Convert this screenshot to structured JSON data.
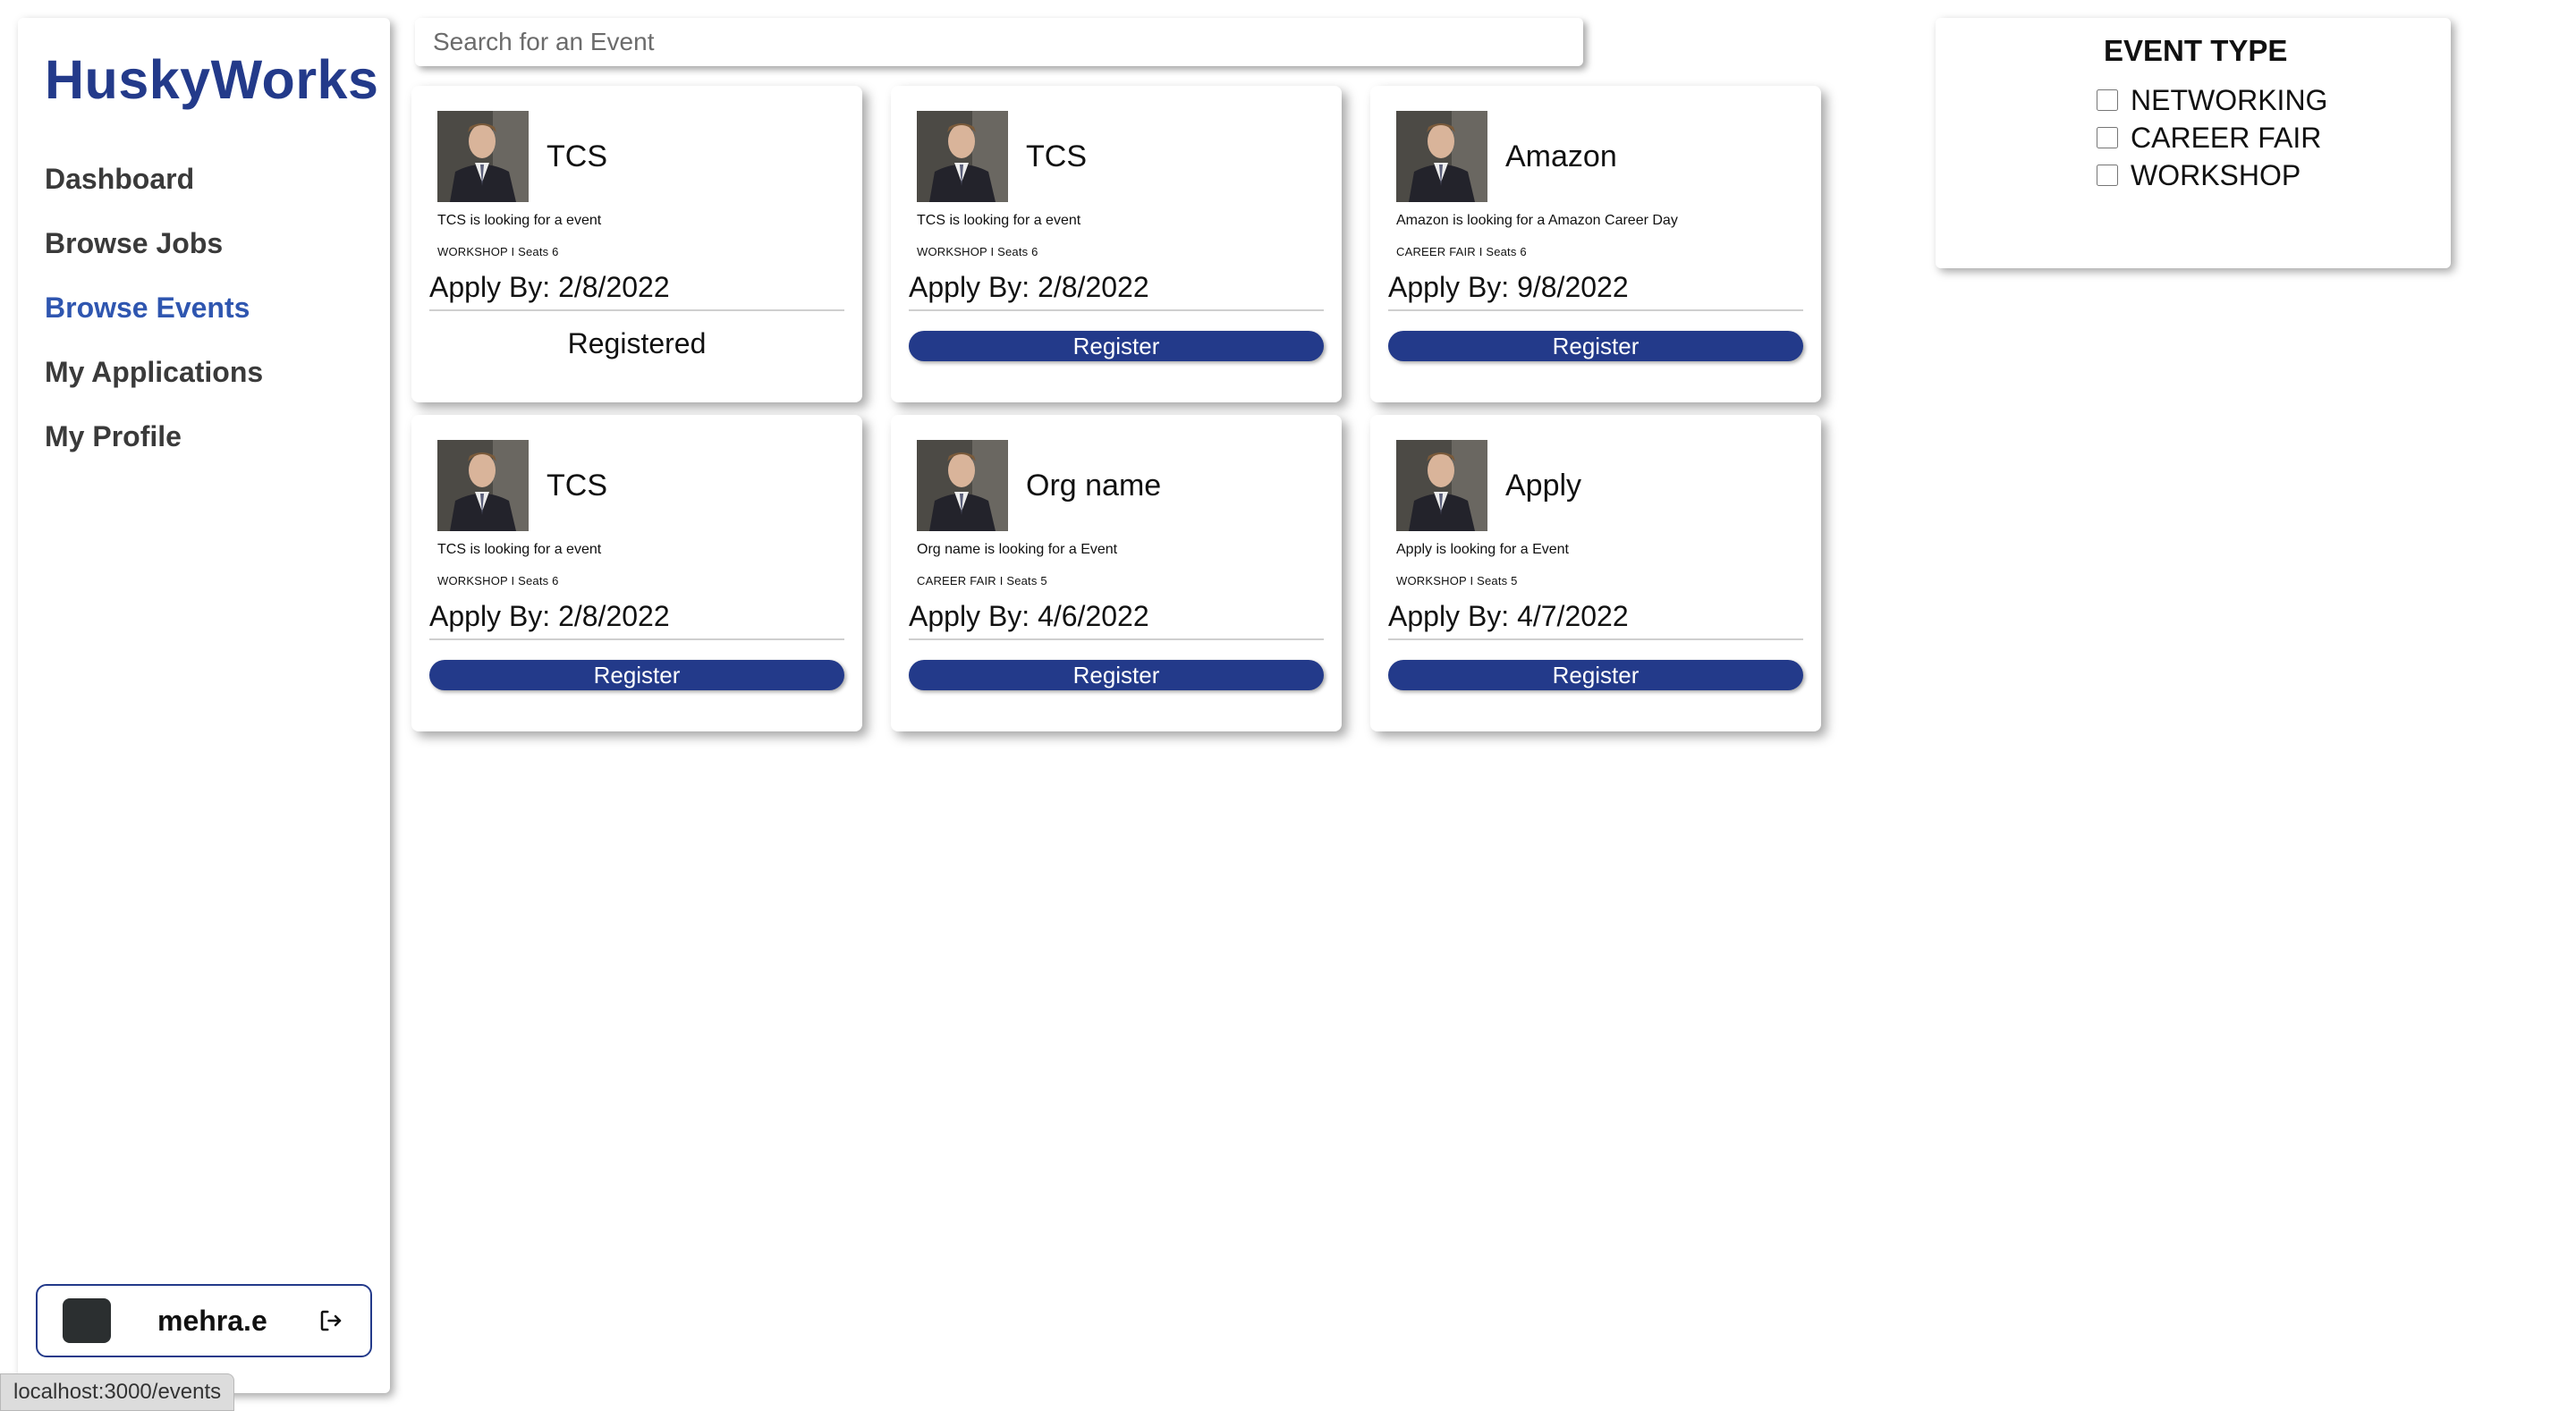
{
  "sidebar": {
    "brand": "HuskyWorks",
    "items": [
      {
        "label": "Dashboard"
      },
      {
        "label": "Browse Jobs"
      },
      {
        "label": "Browse Events"
      },
      {
        "label": "My Applications"
      },
      {
        "label": "My Profile"
      }
    ],
    "active_item": "Browse Events",
    "user": {
      "name": "mehra.e",
      "logout_icon": "logout-icon"
    }
  },
  "search": {
    "placeholder": "Search for an Event",
    "value": ""
  },
  "events": [
    {
      "title": "TCS",
      "description": "TCS is looking for a event",
      "meta": "WORKSHOP I Seats 6",
      "apply_by": "Apply By: 2/8/2022",
      "action": "Registered",
      "registered": true
    },
    {
      "title": "TCS",
      "description": "TCS is looking for a event",
      "meta": "WORKSHOP I Seats 6",
      "apply_by": "Apply By: 2/8/2022",
      "action": "Register",
      "registered": false
    },
    {
      "title": "Amazon",
      "description": "Amazon is looking for a Amazon Career Day",
      "meta": "CAREER FAIR I Seats 6",
      "apply_by": "Apply By: 9/8/2022",
      "action": "Register",
      "registered": false
    },
    {
      "title": "TCS",
      "description": "TCS is looking for a event",
      "meta": "WORKSHOP I Seats 6",
      "apply_by": "Apply By: 2/8/2022",
      "action": "Register",
      "registered": false
    },
    {
      "title": "Org name",
      "description": "Org name is looking for a Event",
      "meta": "CAREER FAIR I Seats 5",
      "apply_by": "Apply By: 4/6/2022",
      "action": "Register",
      "registered": false
    },
    {
      "title": "Apply",
      "description": "Apply is looking for a Event",
      "meta": "WORKSHOP I Seats 5",
      "apply_by": "Apply By: 4/7/2022",
      "action": "Register",
      "registered": false
    }
  ],
  "filter": {
    "title": "EVENT TYPE",
    "options": [
      {
        "label": "NETWORKING",
        "checked": false
      },
      {
        "label": "CAREER FAIR",
        "checked": false
      },
      {
        "label": "WORKSHOP",
        "checked": false
      }
    ]
  },
  "statusbar": {
    "url": "localhost:3000/events"
  },
  "colors": {
    "brand": "#233a8a",
    "active_nav": "#2f56b0",
    "button": "#233a8a"
  }
}
